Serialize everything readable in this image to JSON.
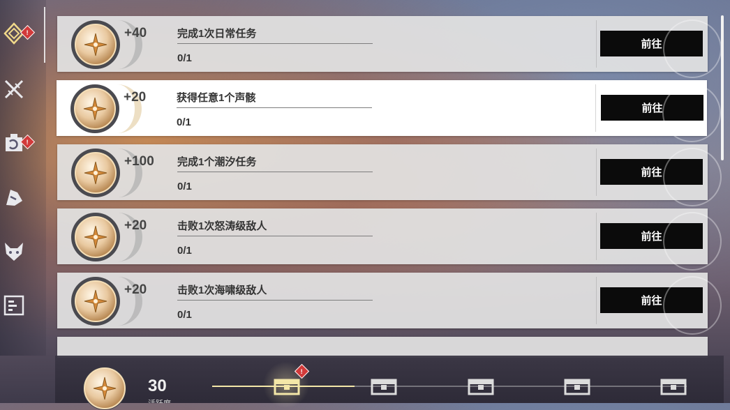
{
  "sidebar": {
    "items": [
      {
        "name": "daily-tasks",
        "alert": "!"
      },
      {
        "name": "combat",
        "alert": ""
      },
      {
        "name": "supply",
        "alert": "!"
      },
      {
        "name": "echo",
        "alert": ""
      },
      {
        "name": "enemy",
        "alert": ""
      },
      {
        "name": "archive",
        "alert": ""
      }
    ]
  },
  "tasks": [
    {
      "points": "+40",
      "description": "完成1次日常任务",
      "progress": "0/1",
      "button": "前往"
    },
    {
      "points": "+20",
      "description": "获得任意1个声骸",
      "progress": "0/1",
      "button": "前往"
    },
    {
      "points": "+100",
      "description": "完成1个潮汐任务",
      "progress": "0/1",
      "button": "前往"
    },
    {
      "points": "+20",
      "description": "击败1次怒涛级敌人",
      "progress": "0/1",
      "button": "前往"
    },
    {
      "points": "+20",
      "description": "击败1次海啸级敌人",
      "progress": "0/1",
      "button": "前往"
    }
  ],
  "bottom": {
    "score": "30",
    "score_label": "活跃度",
    "chest_alert": "!",
    "progress_fraction": 0.3
  },
  "colors": {
    "accent": "#f4e7a8",
    "alert": "#d23a3a",
    "button_bg": "#0b0b0b"
  }
}
